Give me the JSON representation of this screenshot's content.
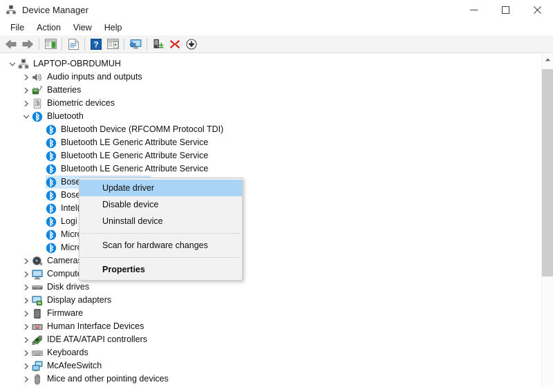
{
  "window": {
    "title": "Device Manager",
    "title_icon": "device-manager-icon",
    "controls": {
      "minimize": "minimize-button",
      "maximize": "maximize-button",
      "close": "close-button"
    }
  },
  "menubar": {
    "items": [
      {
        "label": "File",
        "name": "menu-file"
      },
      {
        "label": "Action",
        "name": "menu-action"
      },
      {
        "label": "View",
        "name": "menu-view"
      },
      {
        "label": "Help",
        "name": "menu-help"
      }
    ]
  },
  "toolbar": {
    "buttons": [
      {
        "name": "back-button",
        "icon": "back-arrow-icon",
        "type": "icon"
      },
      {
        "name": "forward-button",
        "icon": "forward-arrow-icon",
        "type": "icon"
      },
      {
        "name": "separator-1",
        "icon": "separator",
        "type": "separator"
      },
      {
        "name": "show-hide-console-tree-button",
        "icon": "console-tree-icon",
        "type": "icon"
      },
      {
        "name": "separator-2",
        "icon": "separator",
        "type": "separator"
      },
      {
        "name": "properties-button",
        "icon": "properties-page-icon",
        "type": "icon"
      },
      {
        "name": "separator-3",
        "icon": "separator",
        "type": "separator"
      },
      {
        "name": "help-button",
        "icon": "help-question-icon",
        "type": "icon"
      },
      {
        "name": "action-pane-button",
        "icon": "action-pane-icon",
        "type": "icon"
      },
      {
        "name": "separator-4",
        "icon": "separator",
        "type": "separator"
      },
      {
        "name": "scan-for-hardware-changes-button",
        "icon": "monitor-scan-icon",
        "type": "icon"
      },
      {
        "name": "separator-5",
        "icon": "separator",
        "type": "separator"
      },
      {
        "name": "update-driver-button",
        "icon": "update-driver-icon",
        "type": "icon"
      },
      {
        "name": "uninstall-device-button",
        "icon": "red-x-icon",
        "type": "icon"
      },
      {
        "name": "disable-device-button",
        "icon": "down-arrow-circle-icon",
        "type": "icon"
      }
    ]
  },
  "tree": {
    "rows": [
      {
        "label": "LAPTOP-OBRDUMUH",
        "indent": 0,
        "twisty": "expanded",
        "icon": "computer-root-icon",
        "selected": false
      },
      {
        "label": "Audio inputs and outputs",
        "indent": 1,
        "twisty": "collapsed",
        "icon": "speaker-icon",
        "selected": false
      },
      {
        "label": "Batteries",
        "indent": 1,
        "twisty": "collapsed",
        "icon": "battery-icon",
        "selected": false
      },
      {
        "label": "Biometric devices",
        "indent": 1,
        "twisty": "collapsed",
        "icon": "fingerprint-icon",
        "selected": false
      },
      {
        "label": "Bluetooth",
        "indent": 1,
        "twisty": "expanded",
        "icon": "bluetooth-icon",
        "selected": false
      },
      {
        "label": "Bluetooth Device (RFCOMM Protocol TDI)",
        "indent": 2,
        "twisty": "none",
        "icon": "bluetooth-icon",
        "selected": false
      },
      {
        "label": "Bluetooth LE Generic Attribute Service",
        "indent": 2,
        "twisty": "none",
        "icon": "bluetooth-icon",
        "selected": false
      },
      {
        "label": "Bluetooth LE Generic Attribute Service",
        "indent": 2,
        "twisty": "none",
        "icon": "bluetooth-icon",
        "selected": false
      },
      {
        "label": "Bluetooth LE Generic Attribute Service",
        "indent": 2,
        "twisty": "none",
        "icon": "bluetooth-icon",
        "selected": false
      },
      {
        "label": "Bose C",
        "indent": 2,
        "twisty": "none",
        "icon": "bluetooth-icon",
        "selected": true
      },
      {
        "label": "Bose (",
        "indent": 2,
        "twisty": "none",
        "icon": "bluetooth-icon",
        "selected": false
      },
      {
        "label": "Intel(R",
        "indent": 2,
        "twisty": "none",
        "icon": "bluetooth-icon",
        "selected": false
      },
      {
        "label": "Logi M",
        "indent": 2,
        "twisty": "none",
        "icon": "bluetooth-icon",
        "selected": false
      },
      {
        "label": "Micro",
        "indent": 2,
        "twisty": "none",
        "icon": "bluetooth-icon",
        "selected": false
      },
      {
        "label": "Micro",
        "indent": 2,
        "twisty": "none",
        "icon": "bluetooth-icon",
        "selected": false
      },
      {
        "label": "Cameras",
        "indent": 1,
        "twisty": "collapsed",
        "icon": "camera-icon",
        "selected": false
      },
      {
        "label": "Computer",
        "indent": 1,
        "twisty": "collapsed",
        "icon": "monitor-icon",
        "selected": false
      },
      {
        "label": "Disk drives",
        "indent": 1,
        "twisty": "collapsed",
        "icon": "disk-drive-icon",
        "selected": false
      },
      {
        "label": "Display adapters",
        "indent": 1,
        "twisty": "collapsed",
        "icon": "display-adapter-icon",
        "selected": false
      },
      {
        "label": "Firmware",
        "indent": 1,
        "twisty": "collapsed",
        "icon": "firmware-chip-icon",
        "selected": false
      },
      {
        "label": "Human Interface Devices",
        "indent": 1,
        "twisty": "collapsed",
        "icon": "hid-icon",
        "selected": false
      },
      {
        "label": "IDE ATA/ATAPI controllers",
        "indent": 1,
        "twisty": "collapsed",
        "icon": "ide-controller-icon",
        "selected": false
      },
      {
        "label": "Keyboards",
        "indent": 1,
        "twisty": "collapsed",
        "icon": "keyboard-icon",
        "selected": false
      },
      {
        "label": "McAfeeSwitch",
        "indent": 1,
        "twisty": "collapsed",
        "icon": "network-switch-icon",
        "selected": false
      },
      {
        "label": "Mice and other pointing devices",
        "indent": 1,
        "twisty": "collapsed",
        "icon": "mouse-icon",
        "selected": false
      }
    ]
  },
  "context_menu": {
    "items": [
      {
        "label": "Update driver",
        "name": "ctx-update-driver",
        "highlight": true,
        "bold": false,
        "type": "item"
      },
      {
        "label": "Disable device",
        "name": "ctx-disable-device",
        "highlight": false,
        "bold": false,
        "type": "item"
      },
      {
        "label": "Uninstall device",
        "name": "ctx-uninstall-device",
        "highlight": false,
        "bold": false,
        "type": "item"
      },
      {
        "label": "",
        "name": "ctx-separator",
        "highlight": false,
        "bold": false,
        "type": "separator"
      },
      {
        "label": "Scan for hardware changes",
        "name": "ctx-scan-for-hardware-changes",
        "highlight": false,
        "bold": false,
        "type": "item"
      },
      {
        "label": "",
        "name": "ctx-separator-2",
        "highlight": false,
        "bold": false,
        "type": "separator"
      },
      {
        "label": "Properties",
        "name": "ctx-properties",
        "highlight": false,
        "bold": true,
        "type": "item"
      }
    ]
  },
  "scrollbar": {
    "up_arrow": "scroll-up-arrow-icon",
    "thumb": "scroll-thumb"
  },
  "colors": {
    "selection": "#cde8ff",
    "menu_highlight": "#a8d5f7",
    "bluetooth_blue": "#1186e0",
    "toolbar_bg": "#f4f4f4",
    "menu_bg": "#f2f2f2"
  }
}
